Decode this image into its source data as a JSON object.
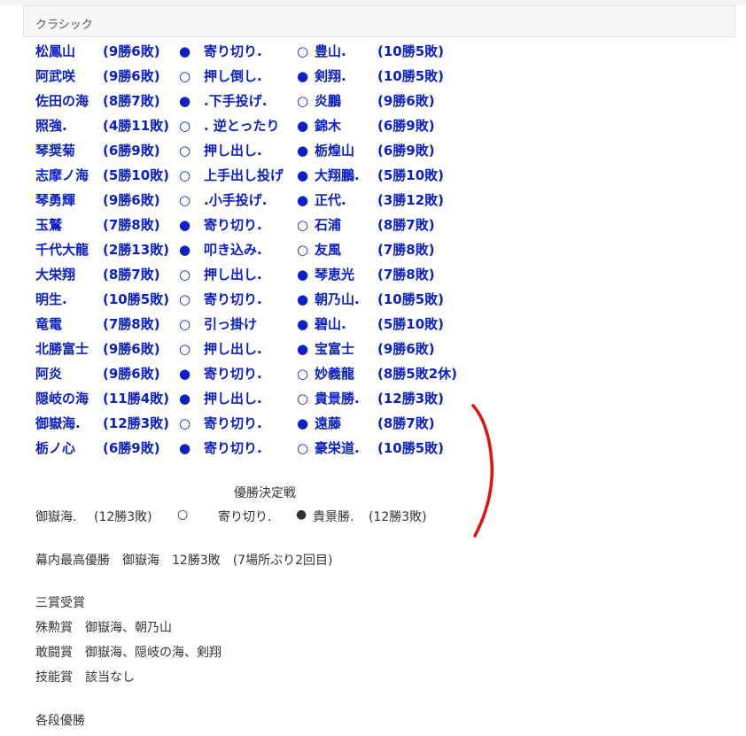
{
  "header": {
    "title": "クラシック"
  },
  "bouts": [
    {
      "east": "松鳳山",
      "east_record": "(9勝6敗)",
      "east_mark": "●",
      "kimarite": "寄り切り.",
      "west_mark": "○",
      "west": "豊山.",
      "west_record": "(10勝5敗)"
    },
    {
      "east": "阿武咲",
      "east_record": "(9勝6敗)",
      "east_mark": "○",
      "kimarite": "押し倒し.",
      "west_mark": "●",
      "west": "剣翔.",
      "west_record": "(10勝5敗)"
    },
    {
      "east": "佐田の海",
      "east_record": "(8勝7敗)",
      "east_mark": "●",
      "kimarite": ".下手投げ.",
      "west_mark": "○",
      "west": "炎鵬",
      "west_record": "(9勝6敗)"
    },
    {
      "east": "照強.",
      "east_record": "(4勝11敗)",
      "east_mark": "○",
      "kimarite": ". 逆とったり",
      "west_mark": "●",
      "west": "錦木",
      "west_record": "(6勝9敗)"
    },
    {
      "east": "琴奨菊",
      "east_record": "(6勝9敗)",
      "east_mark": "○",
      "kimarite": "押し出し.",
      "west_mark": "●",
      "west": "栃煌山",
      "west_record": "(6勝9敗)"
    },
    {
      "east": "志摩ノ海",
      "east_record": "(5勝10敗)",
      "east_mark": "○",
      "kimarite": "上手出し投げ",
      "west_mark": "●",
      "west": "大翔鵬.",
      "west_record": "(5勝10敗)"
    },
    {
      "east": "琴勇輝",
      "east_record": "(9勝6敗)",
      "east_mark": "○",
      "kimarite": ".小手投げ.",
      "west_mark": "●",
      "west": "正代.",
      "west_record": "(3勝12敗)"
    },
    {
      "east": "玉鷲",
      "east_record": "(7勝8敗)",
      "east_mark": "●",
      "kimarite": "寄り切り.",
      "west_mark": "○",
      "west": "石浦",
      "west_record": "(8勝7敗)"
    },
    {
      "east": "千代大龍",
      "east_record": "(2勝13敗)",
      "east_mark": "●",
      "kimarite": "叩き込み.",
      "west_mark": "○",
      "west": "友風",
      "west_record": "(7勝8敗)"
    },
    {
      "east": "大栄翔",
      "east_record": "(8勝7敗)",
      "east_mark": "○",
      "kimarite": "押し出し.",
      "west_mark": "●",
      "west": "琴恵光",
      "west_record": "(7勝8敗)"
    },
    {
      "east": "明生.",
      "east_record": "(10勝5敗)",
      "east_mark": "○",
      "kimarite": "寄り切り.",
      "west_mark": "●",
      "west": "朝乃山.",
      "west_record": "(10勝5敗)"
    },
    {
      "east": "竜電",
      "east_record": "(7勝8敗)",
      "east_mark": "○",
      "kimarite": "引っ掛け",
      "west_mark": "●",
      "west": "碧山.",
      "west_record": "(5勝10敗)"
    },
    {
      "east": "北勝富士",
      "east_record": "(9勝6敗)",
      "east_mark": "○",
      "kimarite": "押し出し.",
      "west_mark": "●",
      "west": "宝富士",
      "west_record": "(9勝6敗)"
    },
    {
      "east": "阿炎",
      "east_record": "(9勝6敗)",
      "east_mark": "●",
      "kimarite": "寄り切り.",
      "west_mark": "○",
      "west": "妙義龍",
      "west_record": "(8勝5敗2休)"
    },
    {
      "east": "隠岐の海",
      "east_record": "(11勝4敗)",
      "east_mark": "●",
      "kimarite": "押し出し.",
      "west_mark": "○",
      "west": "貴景勝.",
      "west_record": "(12勝3敗)"
    },
    {
      "east": "御嶽海.",
      "east_record": "(12勝3敗)",
      "east_mark": "○",
      "kimarite": "寄り切り.",
      "west_mark": "●",
      "west": "遠藤",
      "west_record": "(8勝7敗)"
    },
    {
      "east": "栃ノ心",
      "east_record": "(6勝9敗)",
      "east_mark": "●",
      "kimarite": "寄り切り.",
      "west_mark": "○",
      "west": "豪栄道.",
      "west_record": "(10勝5敗)"
    }
  ],
  "playoff": {
    "title": "優勝決定戦",
    "east": "御嶽海.",
    "east_record": "(12勝3敗)",
    "east_mark": "○",
    "kimarite": "寄り切り.",
    "west_mark": "●",
    "west": "貴景勝.",
    "west_record": "(12勝3敗)"
  },
  "yusho": "幕内最高優勝　御嶽海　12勝3敗　(7場所ぶり2回目)",
  "sansho": {
    "heading": "三賞受賞",
    "shukun": "殊勲賞　御嶽海、朝乃山",
    "kanto": "敢闘賞　御嶽海、隠岐の海、剣翔",
    "gino": "技能賞　該当なし"
  },
  "kakudan": "各段優勝",
  "colors": {
    "bout_text": "#0b20c8",
    "annotation": "#e3120b"
  }
}
